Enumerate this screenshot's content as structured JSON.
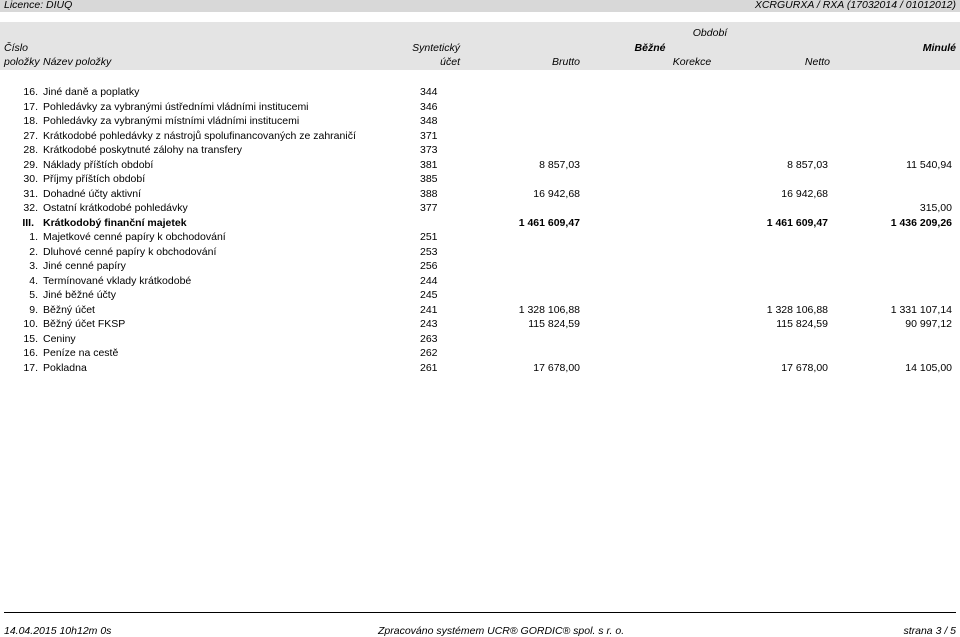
{
  "top": {
    "licence": "Licence: DIUQ",
    "report_id": "XCRGURXA / RXA  (17032014 / 01012012)"
  },
  "header": {
    "obdobi": "Období",
    "cislo": "Číslo",
    "polozky": "položky",
    "nazev": "Název položky",
    "synteticky": "Syntetický",
    "ucet": "účet",
    "bezne": "Běžné",
    "minule": "Minulé",
    "brutto": "Brutto",
    "korekce": "Korekce",
    "netto": "Netto"
  },
  "rows": [
    {
      "num": "16.",
      "name": "Jiné daně a poplatky",
      "account": "344",
      "brutto": "",
      "netto": "",
      "minule": "",
      "bold": false
    },
    {
      "num": "17.",
      "name": "Pohledávky za vybranými ústředními vládními institucemi",
      "account": "346",
      "brutto": "",
      "netto": "",
      "minule": "",
      "bold": false
    },
    {
      "num": "18.",
      "name": "Pohledávky za vybranými místními vládními institucemi",
      "account": "348",
      "brutto": "",
      "netto": "",
      "minule": "",
      "bold": false
    },
    {
      "num": "27.",
      "name": "Krátkodobé pohledávky z nástrojů spolufinancovaných ze zahraničí",
      "account": "371",
      "brutto": "",
      "netto": "",
      "minule": "",
      "bold": false
    },
    {
      "num": "28.",
      "name": "Krátkodobé poskytnuté zálohy na transfery",
      "account": "373",
      "brutto": "",
      "netto": "",
      "minule": "",
      "bold": false
    },
    {
      "num": "29.",
      "name": "Náklady příštích období",
      "account": "381",
      "brutto": "8 857,03",
      "netto": "8 857,03",
      "minule": "11 540,94",
      "bold": false
    },
    {
      "num": "30.",
      "name": "Příjmy příštích období",
      "account": "385",
      "brutto": "",
      "netto": "",
      "minule": "",
      "bold": false
    },
    {
      "num": "31.",
      "name": "Dohadné účty aktivní",
      "account": "388",
      "brutto": "16 942,68",
      "netto": "16 942,68",
      "minule": "",
      "bold": false
    },
    {
      "num": "32.",
      "name": "Ostatní krátkodobé pohledávky",
      "account": "377",
      "brutto": "",
      "netto": "",
      "minule": "315,00",
      "bold": false
    },
    {
      "num": "III.",
      "name": "Krátkodobý finanční majetek",
      "account": "",
      "brutto": "1 461 609,47",
      "netto": "1 461 609,47",
      "minule": "1 436 209,26",
      "bold": true
    },
    {
      "num": "1.",
      "name": "Majetkové cenné papíry k obchodování",
      "account": "251",
      "brutto": "",
      "netto": "",
      "minule": "",
      "bold": false
    },
    {
      "num": "2.",
      "name": "Dluhové cenné papíry k obchodování",
      "account": "253",
      "brutto": "",
      "netto": "",
      "minule": "",
      "bold": false
    },
    {
      "num": "3.",
      "name": "Jiné cenné papíry",
      "account": "256",
      "brutto": "",
      "netto": "",
      "minule": "",
      "bold": false
    },
    {
      "num": "4.",
      "name": "Termínované vklady krátkodobé",
      "account": "244",
      "brutto": "",
      "netto": "",
      "minule": "",
      "bold": false
    },
    {
      "num": "5.",
      "name": "Jiné běžné účty",
      "account": "245",
      "brutto": "",
      "netto": "",
      "minule": "",
      "bold": false
    },
    {
      "num": "9.",
      "name": "Běžný účet",
      "account": "241",
      "brutto": "1 328 106,88",
      "netto": "1 328 106,88",
      "minule": "1 331 107,14",
      "bold": false
    },
    {
      "num": "10.",
      "name": "Běžný účet FKSP",
      "account": "243",
      "brutto": "115 824,59",
      "netto": "115 824,59",
      "minule": "90 997,12",
      "bold": false
    },
    {
      "num": "15.",
      "name": "Ceniny",
      "account": "263",
      "brutto": "",
      "netto": "",
      "minule": "",
      "bold": false
    },
    {
      "num": "16.",
      "name": "Peníze na cestě",
      "account": "262",
      "brutto": "",
      "netto": "",
      "minule": "",
      "bold": false
    },
    {
      "num": "17.",
      "name": "Pokladna",
      "account": "261",
      "brutto": "17 678,00",
      "netto": "17 678,00",
      "minule": "14 105,00",
      "bold": false
    }
  ],
  "footer": {
    "date": "14.04.2015 10h12m 0s",
    "system": "Zpracováno systémem UCR® GORDIC® spol. s  r. o.",
    "page": "strana 3 / 5"
  }
}
